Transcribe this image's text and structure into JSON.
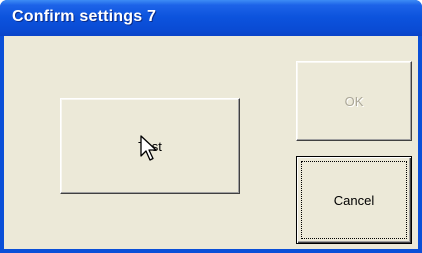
{
  "window": {
    "title": "Confirm settings 7"
  },
  "buttons": {
    "test_label": "Test",
    "ok_label": "OK",
    "cancel_label": "Cancel"
  },
  "state": {
    "ok_enabled": false,
    "focused_button": "Cancel"
  },
  "cursor": {
    "icon": "arrow-pointer-icon"
  },
  "colors": {
    "titlebar": "#0a4fd8",
    "client_background": "#ece9d8",
    "disabled_text": "#aca899"
  }
}
